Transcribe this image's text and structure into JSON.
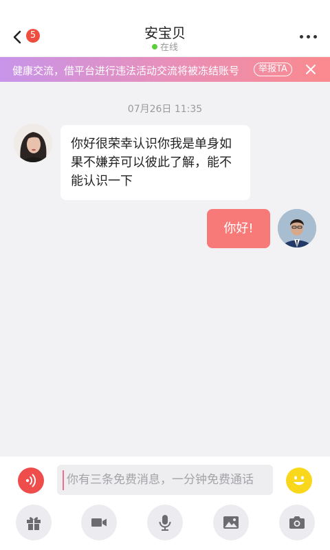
{
  "header": {
    "unread_count": "5",
    "title": "安宝贝",
    "status": "在线"
  },
  "notice": {
    "text": "健康交流，借平台进行违法活动交流将被冻结账号",
    "report_label": "举报TA"
  },
  "chat": {
    "timestamp": "07月26日   11:35",
    "messages": [
      {
        "from": "other",
        "text": "你好很荣幸认识你我是单身如果不嫌弃可以彼此了解，能不能认识一下"
      },
      {
        "from": "me",
        "text": "你好!"
      }
    ]
  },
  "composer": {
    "placeholder": "你有三条免费消息，一分钟免费通话"
  },
  "toolbar": {
    "tools": [
      "gift-icon",
      "video-call-icon",
      "microphone-icon",
      "image-icon",
      "camera-icon"
    ]
  },
  "colors": {
    "accent": "#f87a78",
    "online": "#5ccf3b",
    "badge": "#ee4d3f",
    "emoji": "#f9d71c"
  }
}
